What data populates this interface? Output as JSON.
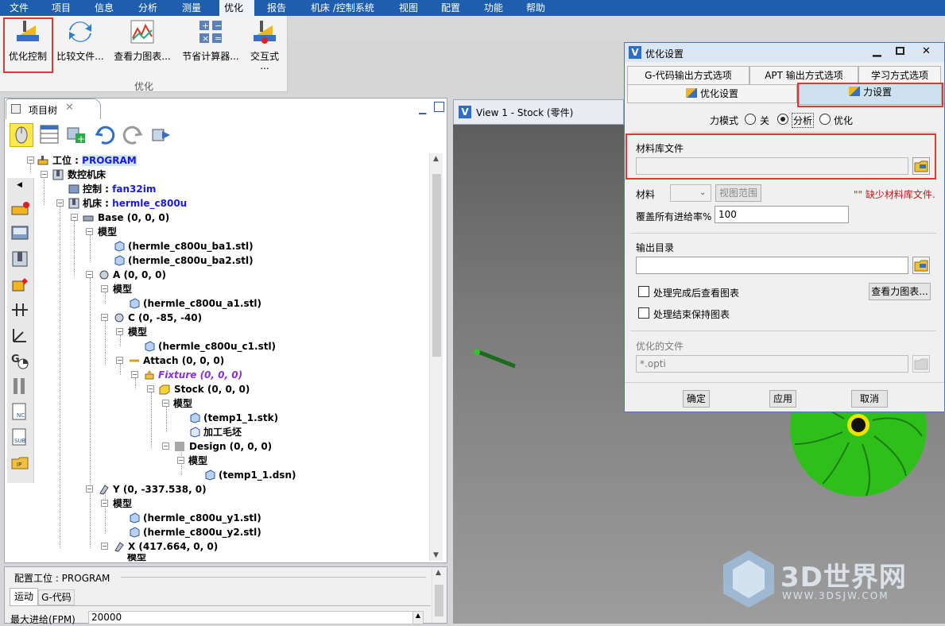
{
  "menu": [
    "文件",
    "项目",
    "信息",
    "分析",
    "测量",
    "优化",
    "报告",
    "机床 /控制系统",
    "视图",
    "配置",
    "功能",
    "帮助"
  ],
  "ribbon": {
    "buttons": [
      {
        "label": "优化控制",
        "icon": "optimize-control-icon"
      },
      {
        "label": "比较文件...",
        "icon": "compare-files-icon"
      },
      {
        "label": "查看力图表...",
        "icon": "force-chart-icon"
      },
      {
        "label": "节省计算器...",
        "icon": "savings-calculator-icon"
      },
      {
        "label": "交互式",
        "icon": "interactive-icon"
      }
    ],
    "more": "...",
    "group": "优化"
  },
  "tree": {
    "tab": "项目树",
    "nodes": [
      {
        "prefix": "工位 : ",
        "value": "PROGRAM"
      },
      {
        "prefix": "数控机床",
        "value": ""
      },
      {
        "prefix": "控制 : ",
        "value": "fan32im"
      },
      {
        "prefix": "机床 : ",
        "value": "hermle_c800u"
      },
      {
        "prefix": "Base (0, 0, 0)",
        "value": ""
      },
      {
        "prefix": "模型",
        "value": ""
      },
      {
        "prefix": "(hermle_c800u_ba1.stl)",
        "value": ""
      },
      {
        "prefix": "(hermle_c800u_ba2.stl)",
        "value": ""
      },
      {
        "prefix": "A (0, 0, 0)",
        "value": ""
      },
      {
        "prefix": "模型",
        "value": ""
      },
      {
        "prefix": "(hermle_c800u_a1.stl)",
        "value": ""
      },
      {
        "prefix": "C (0, -85, -40)",
        "value": ""
      },
      {
        "prefix": "模型",
        "value": ""
      },
      {
        "prefix": "(hermle_c800u_c1.stl)",
        "value": ""
      },
      {
        "prefix": "Attach (0, 0, 0)",
        "value": ""
      },
      {
        "prefix": "Fixture (0, 0, 0)",
        "value": ""
      },
      {
        "prefix": "Stock (0, 0, 0)",
        "value": ""
      },
      {
        "prefix": "模型",
        "value": ""
      },
      {
        "prefix": "(temp1_1.stk)",
        "value": ""
      },
      {
        "prefix": "加工毛坯",
        "value": ""
      },
      {
        "prefix": "Design (0, 0, 0)",
        "value": ""
      },
      {
        "prefix": "模型",
        "value": ""
      },
      {
        "prefix": "(temp1_1.dsn)",
        "value": ""
      },
      {
        "prefix": "Y (0, -337.538, 0)",
        "value": ""
      },
      {
        "prefix": "模型",
        "value": ""
      },
      {
        "prefix": "(hermle_c800u_y1.stl)",
        "value": ""
      },
      {
        "prefix": "(hermle_c800u_y2.stl)",
        "value": ""
      },
      {
        "prefix": "X (417.664, 0, 0)",
        "value": ""
      },
      {
        "prefix": "模型",
        "value": ""
      }
    ]
  },
  "config": {
    "title": "配置工位 : PROGRAM",
    "tabs": [
      "运动",
      "G-代码"
    ],
    "row_label": "最大进给(FPM)",
    "row_value": "20000"
  },
  "view": {
    "title": "View 1 - Stock (零件)"
  },
  "dialog": {
    "title": "优化设置",
    "tabs_top": [
      "G-代码输出方式选项",
      "APT 输出方式选项",
      "学习方式选项"
    ],
    "tabs_bottom": [
      "优化设置",
      "力设置"
    ],
    "mode_label": "力模式",
    "mode_options": [
      "关",
      "分析",
      "优化"
    ],
    "mode_selected": "分析",
    "material_lib_label": "材料库文件",
    "material_label": "材料",
    "view_range": "视图范围",
    "missing_msg": "\"\" 缺少材料库文件.",
    "override_label": "覆盖所有进给率%",
    "override_value": "100",
    "output_dir_label": "输出目录",
    "check1": "处理完成后查看图表",
    "check2": "处理结束保持图表",
    "view_chart_btn": "查看力图表...",
    "opt_file_label": "优化的文件",
    "opt_file_value": "*.opti",
    "ok": "确定",
    "apply": "应用",
    "cancel": "取消"
  },
  "watermark": {
    "brand": "3D世界网",
    "url": "WWW.3DSJW.COM"
  },
  "colors": {
    "menubar": "#1d5fae",
    "highlight": "#e0353a",
    "tree_blue": "#1a1ae0",
    "fixture": "#8b2fd6",
    "part_green": "#2fbf1a"
  }
}
